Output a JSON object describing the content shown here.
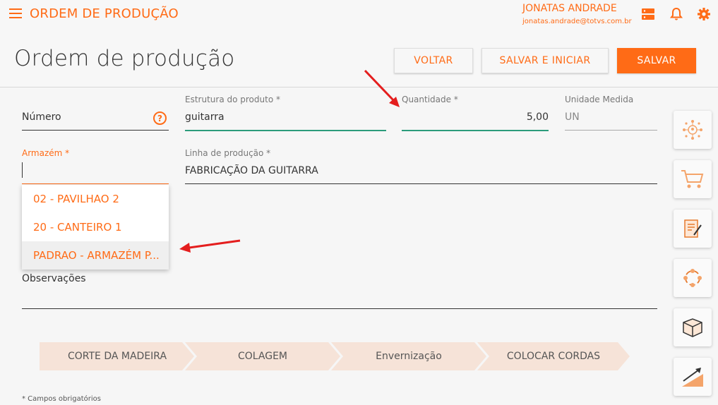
{
  "app": {
    "title": "ORDEM DE PRODUÇÃO",
    "user_name": "JONATAS ANDRADE",
    "user_email": "jonatas.andrade@totvs.com.br",
    "accent_color": "#ff6b16"
  },
  "page": {
    "title": "Ordem de produção",
    "buttons": {
      "back": "VOLTAR",
      "save_start": "SALVAR E INICIAR",
      "save": "SALVAR"
    }
  },
  "form": {
    "numero": {
      "label": "Número",
      "value": ""
    },
    "estrutura": {
      "label": "Estrutura do produto *",
      "value": "guitarra"
    },
    "quantidade": {
      "label": "Quantidade *",
      "value": "5,00"
    },
    "unidade": {
      "label": "Unidade Medida",
      "value": "UN"
    },
    "armazem": {
      "label": "Armazém *",
      "value": ""
    },
    "linha": {
      "label": "Linha de produção *",
      "value": "FABRICAÇÃO DA GUITARRA"
    },
    "observacoes": {
      "label": "Observações",
      "value": ""
    }
  },
  "dropdown": {
    "options": [
      "02 - PAVILHAO 2",
      "20 - CANTEIRO 1",
      "PADRAO - ARMAZÉM P..."
    ],
    "highlighted_index": 2
  },
  "steps": [
    "CORTE DA MADEIRA",
    "COLAGEM",
    "Envernização",
    "COLOCAR CORDAS"
  ],
  "footnote": "* Campos obrigatórios",
  "side_buttons": [
    "network-icon",
    "cart-icon",
    "document-sign-icon",
    "cycle-icon",
    "box-icon",
    "growth-chart-icon"
  ]
}
